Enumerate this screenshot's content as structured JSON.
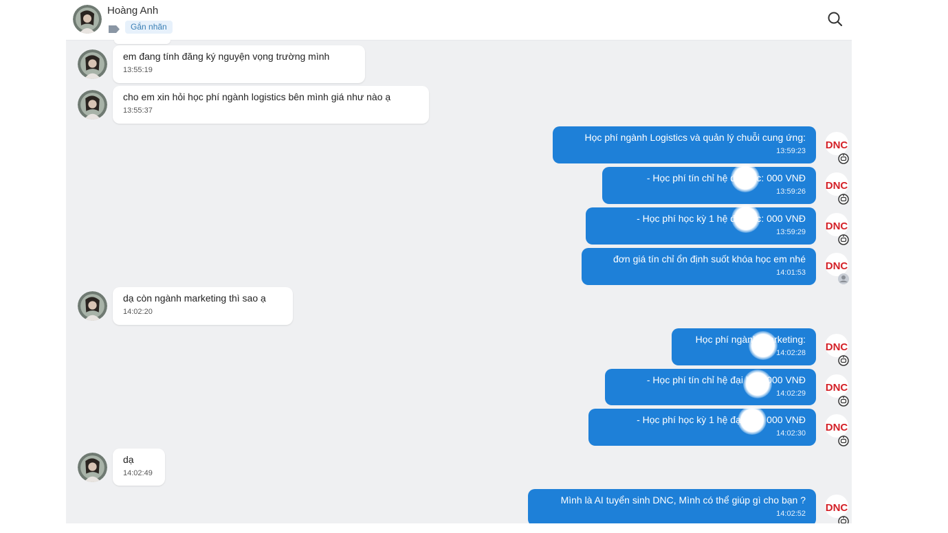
{
  "header": {
    "contact_name": "Hoàng Anh",
    "tag_label": "Gắn nhãn",
    "search_icon": "search-icon"
  },
  "messages": [
    {
      "side": "in",
      "text": "em đang tính đăng ký nguyện vọng trường mình",
      "time": "13:55:19"
    },
    {
      "side": "in",
      "text": "cho em xin hỏi học phí ngành logistics bên mình giá như nào ạ",
      "time": "13:55:37"
    },
    {
      "side": "out",
      "text": "Học phí ngành Logistics và quản lý chuỗi cung ứng:",
      "time": "13:59:23"
    },
    {
      "side": "out",
      "text": "- Học phí tín chỉ hệ đại học:       000 VNĐ",
      "time": "13:59:26"
    },
    {
      "side": "out",
      "text": "- Học phí học kỳ 1 hệ đại học:       000 VNĐ",
      "time": "13:59:29"
    },
    {
      "side": "out",
      "text": "đơn giá tín chỉ ổn định suốt khóa học em nhé",
      "time": "14:01:53"
    },
    {
      "side": "in",
      "text": "dạ còn ngành marketing thì sao ạ",
      "time": "14:02:20"
    },
    {
      "side": "out",
      "text": "Học phí ngành Marketing:",
      "time": "14:02:28"
    },
    {
      "side": "out",
      "text": "- Học phí tín chỉ hệ đại học:       000 VNĐ",
      "time": "14:02:29"
    },
    {
      "side": "out",
      "text": "- Học phí học kỳ 1 hệ đại học:       000 VNĐ",
      "time": "14:02:30"
    },
    {
      "side": "in",
      "text": "dạ",
      "time": "14:02:49"
    },
    {
      "side": "out",
      "text": "Mình là AI tuyển sinh DNC, Mình có thể giúp gì cho bạn ?",
      "time": "14:02:52"
    }
  ],
  "bot_logo_text": "DNC",
  "colors": {
    "outgoing_bubble": "#1e80d8",
    "background": "#eff0f2",
    "incoming_bubble": "#ffffff",
    "logo_red": "#d42027"
  }
}
